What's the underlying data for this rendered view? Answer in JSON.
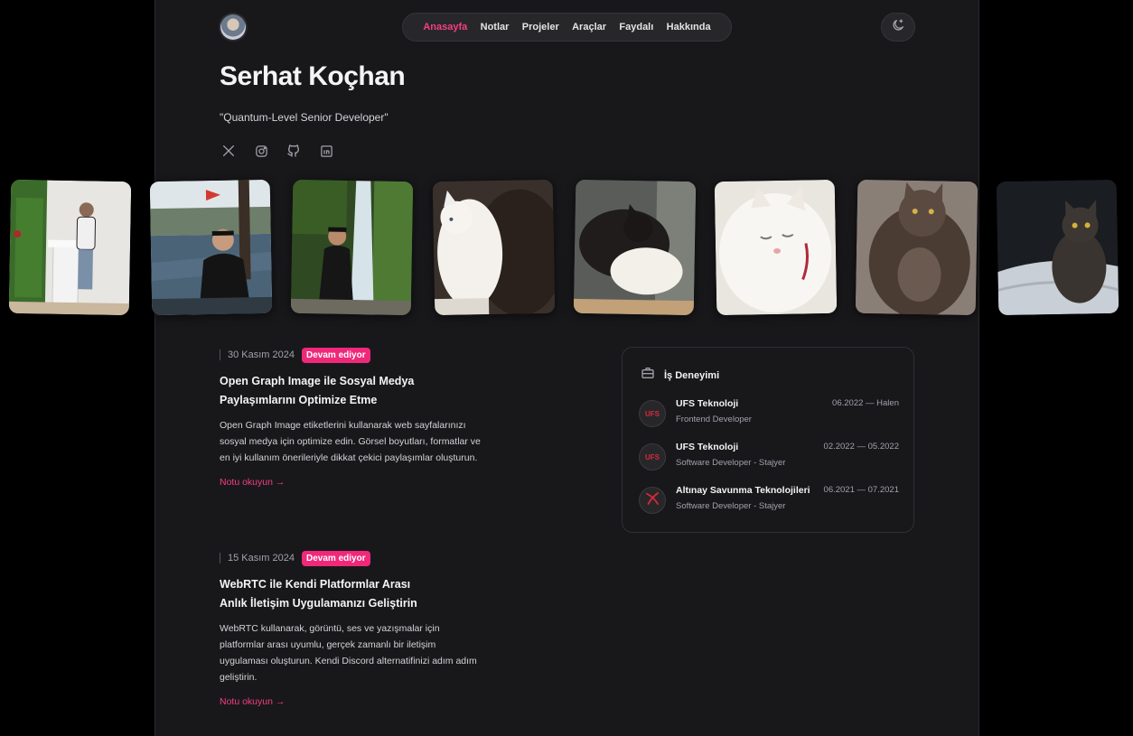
{
  "nav": {
    "items": [
      {
        "label": "Anasayfa",
        "active": true
      },
      {
        "label": "Notlar",
        "active": false
      },
      {
        "label": "Projeler",
        "active": false
      },
      {
        "label": "Araçlar",
        "active": false
      },
      {
        "label": "Faydalı",
        "active": false
      },
      {
        "label": "Hakkında",
        "active": false
      }
    ],
    "theme_toggle_icon": "moon-sparkle-icon"
  },
  "profile": {
    "name": "Serhat Koçhan",
    "tagline": "\"Quantum-Level Senior Developer\"",
    "socials": [
      "x-icon",
      "instagram-icon",
      "github-icon",
      "linkedin-icon"
    ]
  },
  "gallery": [
    "photo-person-presenting",
    "photo-person-by-sea",
    "photo-person-waterfall",
    "photo-white-and-dark-cats",
    "photo-cats-cuddling",
    "photo-white-cat-sleeping",
    "photo-fluffy-cat-lying",
    "photo-dark-cat-on-bed"
  ],
  "posts": [
    {
      "date": "30 Kasım 2024",
      "badge": "Devam ediyor",
      "title": "Open Graph Image ile Sosyal Medya Paylaşımlarını Optimize Etme",
      "description": "Open Graph Image etiketlerini kullanarak web sayfalarınızı sosyal medya için optimize edin. Görsel boyutları, formatlar ve en iyi kullanım önerileriyle dikkat çekici paylaşımlar oluşturun.",
      "link": "Notu okuyun →"
    },
    {
      "date": "15 Kasım 2024",
      "badge": "Devam ediyor",
      "title": "WebRTC ile Kendi Platformlar Arası Anlık İletişim Uygulamanızı Geliştirin",
      "description": "WebRTC kullanarak, görüntü, ses ve yazışmalar için platformlar arası uyumlu, gerçek zamanlı bir iletişim uygulaması oluşturun. Kendi Discord alternatifinizi adım adım geliştirin.",
      "link": "Notu okuyun →"
    }
  ],
  "work": {
    "title": "İş Deneyimi",
    "jobs": [
      {
        "company": "UFS Teknoloji",
        "role": "Frontend Developer",
        "period": "06.2022 — Halen",
        "logo_text": "UFS"
      },
      {
        "company": "UFS Teknoloji",
        "role": "Software Developer - Stajyer",
        "period": "02.2022 — 05.2022",
        "logo_text": "UFS"
      },
      {
        "company": "Altınay Savunma Teknolojileri",
        "role": "Software Developer - Stajyer",
        "period": "06.2021 — 07.2021",
        "logo_text": ""
      }
    ]
  },
  "colors": {
    "accent": "#f43f7f",
    "badge": "#f0287a",
    "background": "#18181b",
    "page": "#000000"
  }
}
